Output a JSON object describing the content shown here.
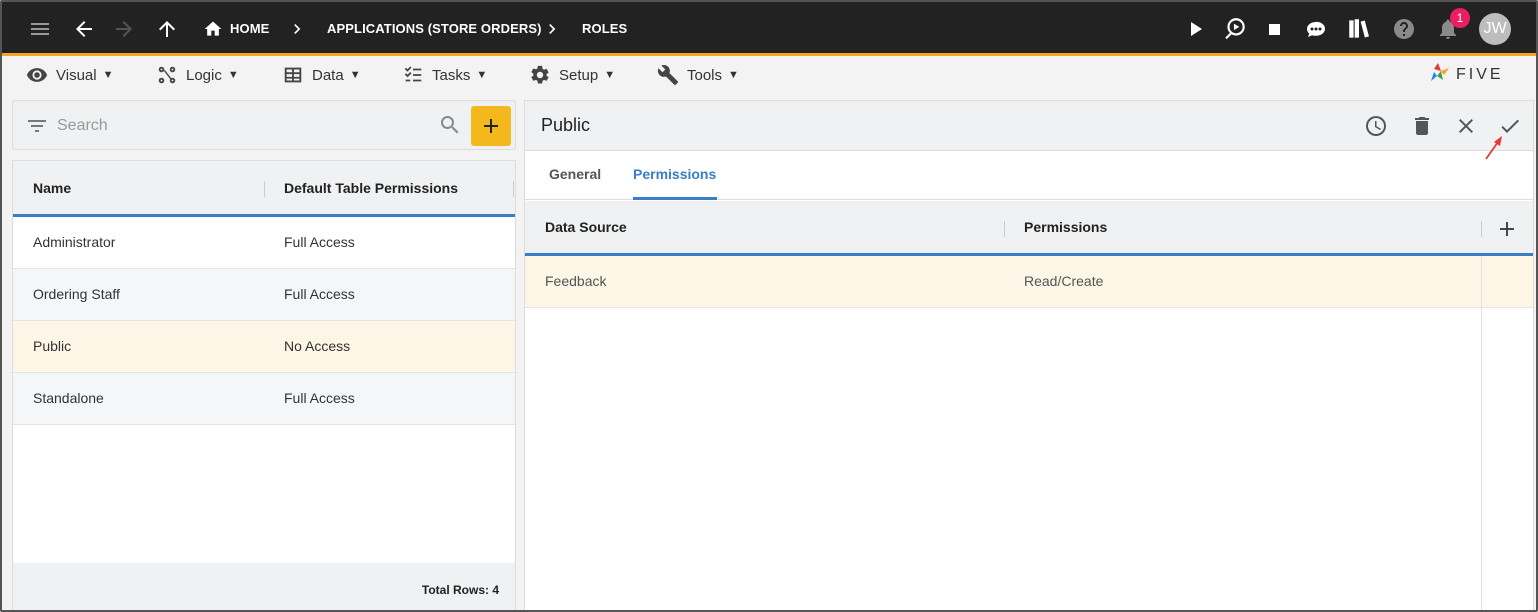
{
  "topbar": {
    "breadcrumbs": [
      "HOME",
      "APPLICATIONS (STORE ORDERS)",
      "ROLES"
    ],
    "avatar_initials": "JW",
    "notification_count": "1",
    "accent_color": "#f5a623"
  },
  "menubar": {
    "items": [
      {
        "label": "Visual",
        "icon": "eye-icon"
      },
      {
        "label": "Logic",
        "icon": "logic-icon"
      },
      {
        "label": "Data",
        "icon": "table-icon"
      },
      {
        "label": "Tasks",
        "icon": "checklist-icon"
      },
      {
        "label": "Setup",
        "icon": "gear-icon"
      },
      {
        "label": "Tools",
        "icon": "tools-icon"
      }
    ],
    "logo_text": "FIVE"
  },
  "search": {
    "placeholder": "Search"
  },
  "roles_list": {
    "columns": [
      "Name",
      "Default Table Permissions"
    ],
    "rows": [
      {
        "name": "Administrator",
        "permission": "Full Access"
      },
      {
        "name": "Ordering Staff",
        "permission": "Full Access"
      },
      {
        "name": "Public",
        "permission": "No Access"
      },
      {
        "name": "Standalone",
        "permission": "Full Access"
      }
    ],
    "selected_index": 2,
    "footer": "Total Rows: 4"
  },
  "detail": {
    "title": "Public",
    "tabs": [
      "General",
      "Permissions"
    ],
    "active_tab": "Permissions",
    "table": {
      "columns": [
        "Data Source",
        "Permissions"
      ],
      "rows": [
        {
          "data_source": "Feedback",
          "permissions": "Read/Create"
        }
      ]
    }
  },
  "colors": {
    "selected_row": "#fdf5e6",
    "add_button": "#f5b81c",
    "tab_active": "#3a7ec6",
    "annotation_arrow": "#e53935"
  }
}
